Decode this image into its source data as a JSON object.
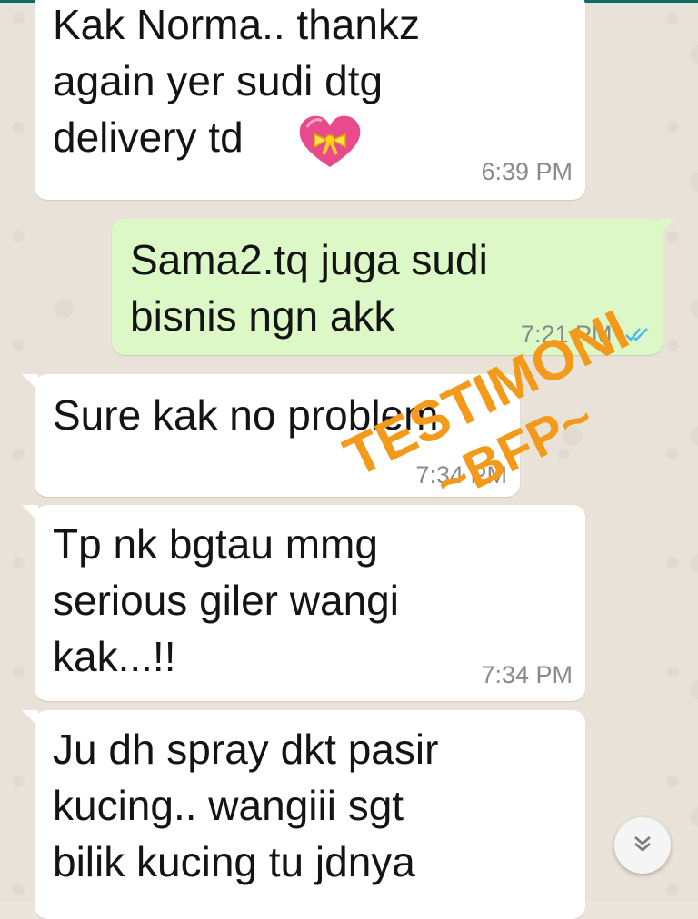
{
  "messages": [
    {
      "direction": "in",
      "text": "Kak Norma.. thankz\nagain yer sudi dtg\ndelivery td",
      "time": "6:39 PM",
      "emoji": "heart-with-ribbon"
    },
    {
      "direction": "out",
      "text": "Sama2.tq juga sudi\nbisnis ngn akk",
      "time": "7:21 PM",
      "status": "read"
    },
    {
      "direction": "in",
      "text": "Sure kak no problem",
      "time": "7:34 PM"
    },
    {
      "direction": "in",
      "text": "Tp nk bgtau mmg\nserious giler wangi\nkak...!!",
      "time": "7:34 PM"
    },
    {
      "direction": "in",
      "text": "Ju dh spray dkt pasir\nkucing.. wangiii sgt\nbilik kucing tu jdnya"
    }
  ],
  "watermark": {
    "line1": "TESTIMONI",
    "line2": "~BFP~",
    "color": "#f39a1a"
  },
  "icons": {
    "read_ticks": "double-check-icon",
    "scroll_down": "double-chevron-down-icon"
  },
  "colors": {
    "incoming": "#ffffff",
    "outgoing": "#dcf8c6",
    "read_tick": "#4fb6ec",
    "background": "#ece5dd"
  }
}
